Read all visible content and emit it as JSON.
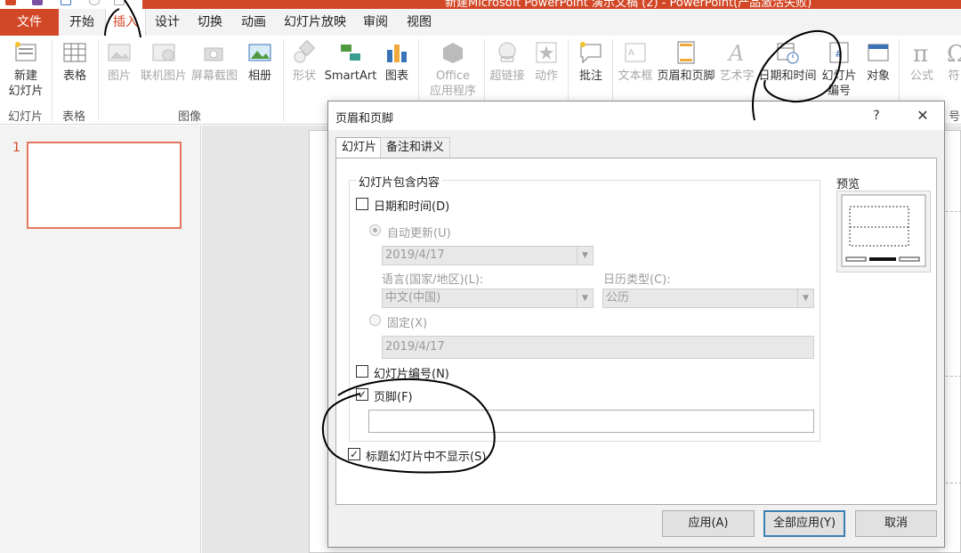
{
  "window": {
    "title": "新建Microsoft PowerPoint 演示文稿 (2) - PowerPoint(产品激活失败)"
  },
  "menu": {
    "file": "文件",
    "tabs": [
      "开始",
      "插入",
      "设计",
      "切换",
      "动画",
      "幻灯片放映",
      "审阅",
      "视图"
    ],
    "active_tab": "插入"
  },
  "ribbon": {
    "new_slide": "新建\n幻灯片",
    "table": "表格",
    "picture": "图片",
    "online_picture": "联机图片",
    "screenshot": "屏幕截图",
    "album": "相册",
    "shapes": "形状",
    "smartart": "SmartArt",
    "chart": "图表",
    "office_apps": "Office\n应用程序",
    "hyperlink": "超链接",
    "action": "动作",
    "comment": "批注",
    "textbox": "文本框",
    "header_footer": "页眉和页脚",
    "wordart": "艺术字",
    "datetime": "日期和时间",
    "slide_number": "幻灯片\n编号",
    "object": "对象",
    "equation": "公式",
    "symbol": "符",
    "groups": {
      "slides": "幻灯片",
      "tables": "表格",
      "images": "图像",
      "symbols_tail": "号"
    }
  },
  "thumbnails": {
    "slide_number": "1"
  },
  "dialog": {
    "title": "页眉和页脚",
    "help": "?",
    "close": "✕",
    "tabs": {
      "slide": "幻灯片",
      "notes": "备注和讲义"
    },
    "group_title": "幻灯片包含内容",
    "datetime_label": "日期和时间(D)",
    "datetime_checked": false,
    "auto_update_label": "自动更新(U)",
    "auto_update_value": "2019/4/17",
    "language_label": "语言(国家/地区)(L):",
    "language_value": "中文(中国)",
    "calendar_label": "日历类型(C):",
    "calendar_value": "公历",
    "fixed_label": "固定(X)",
    "fixed_value": "2019/4/17",
    "slide_number_label": "幻灯片编号(N)",
    "slide_number_checked": false,
    "footer_label": "页脚(F)",
    "footer_checked": true,
    "footer_value": "",
    "hide_on_title_label": "标题幻灯片中不显示(S)",
    "hide_on_title_checked": true,
    "preview_label": "预览",
    "buttons": {
      "apply": "应用(A)",
      "apply_all": "全部应用(Y)",
      "cancel": "取消"
    }
  },
  "colors": {
    "accent": "#d24726",
    "dialog_bg": "#f0f0f0",
    "ink": "#000000"
  }
}
